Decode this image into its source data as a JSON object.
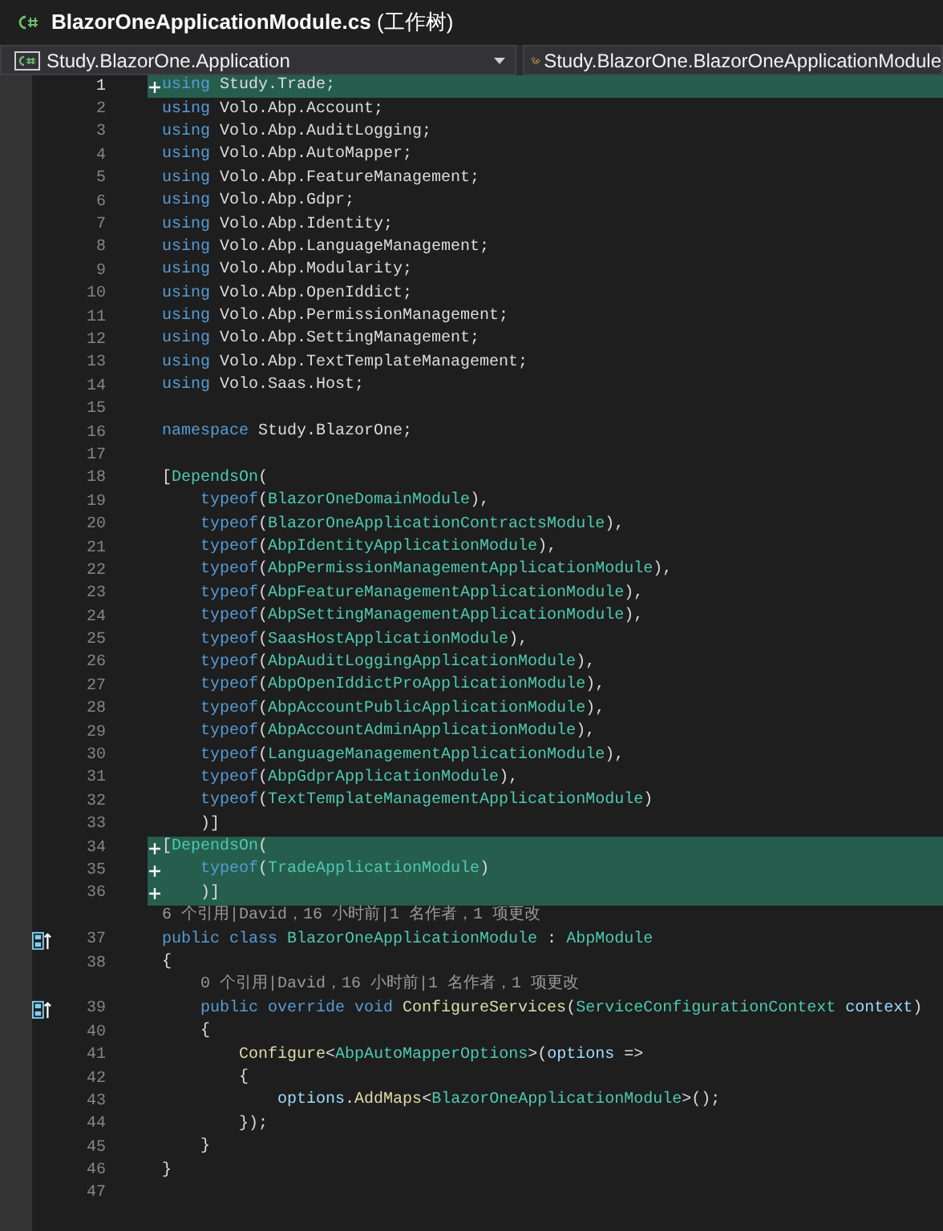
{
  "tab": {
    "title": "BlazorOneApplicationModule.cs",
    "suffix": "(工作树)"
  },
  "navigation": {
    "project": "Study.BlazorOne.Application",
    "member": "Study.BlazorOne.BlazorOneApplicationModule"
  },
  "lines": [
    {
      "kind": "code",
      "number": "1",
      "current": true,
      "added": true,
      "tokens": [
        {
          "kind": "keyword",
          "t": "using"
        },
        {
          "kind": "plain",
          "t": " Study.Trade;"
        }
      ]
    },
    {
      "kind": "code",
      "number": "2",
      "tokens": [
        {
          "kind": "keyword",
          "t": "using"
        },
        {
          "kind": "plain",
          "t": " Volo.Abp.Account;"
        }
      ]
    },
    {
      "kind": "code",
      "number": "3",
      "tokens": [
        {
          "kind": "keyword",
          "t": "using"
        },
        {
          "kind": "plain",
          "t": " Volo.Abp.AuditLogging;"
        }
      ]
    },
    {
      "kind": "code",
      "number": "4",
      "tokens": [
        {
          "kind": "keyword",
          "t": "using"
        },
        {
          "kind": "plain",
          "t": " Volo.Abp.AutoMapper;"
        }
      ]
    },
    {
      "kind": "code",
      "number": "5",
      "tokens": [
        {
          "kind": "keyword",
          "t": "using"
        },
        {
          "kind": "plain",
          "t": " Volo.Abp.FeatureManagement;"
        }
      ]
    },
    {
      "kind": "code",
      "number": "6",
      "tokens": [
        {
          "kind": "keyword",
          "t": "using"
        },
        {
          "kind": "plain",
          "t": " Volo.Abp.Gdpr;"
        }
      ]
    },
    {
      "kind": "code",
      "number": "7",
      "tokens": [
        {
          "kind": "keyword",
          "t": "using"
        },
        {
          "kind": "plain",
          "t": " Volo.Abp.Identity;"
        }
      ]
    },
    {
      "kind": "code",
      "number": "8",
      "tokens": [
        {
          "kind": "keyword",
          "t": "using"
        },
        {
          "kind": "plain",
          "t": " Volo.Abp.LanguageManagement;"
        }
      ]
    },
    {
      "kind": "code",
      "number": "9",
      "tokens": [
        {
          "kind": "keyword",
          "t": "using"
        },
        {
          "kind": "plain",
          "t": " Volo.Abp.Modularity;"
        }
      ]
    },
    {
      "kind": "code",
      "number": "10",
      "tokens": [
        {
          "kind": "keyword",
          "t": "using"
        },
        {
          "kind": "plain",
          "t": " Volo.Abp.OpenIddict;"
        }
      ]
    },
    {
      "kind": "code",
      "number": "11",
      "tokens": [
        {
          "kind": "keyword",
          "t": "using"
        },
        {
          "kind": "plain",
          "t": " Volo.Abp.PermissionManagement;"
        }
      ]
    },
    {
      "kind": "code",
      "number": "12",
      "tokens": [
        {
          "kind": "keyword",
          "t": "using"
        },
        {
          "kind": "plain",
          "t": " Volo.Abp.SettingManagement;"
        }
      ]
    },
    {
      "kind": "code",
      "number": "13",
      "tokens": [
        {
          "kind": "keyword",
          "t": "using"
        },
        {
          "kind": "plain",
          "t": " Volo.Abp.TextTemplateManagement;"
        }
      ]
    },
    {
      "kind": "code",
      "number": "14",
      "tokens": [
        {
          "kind": "keyword",
          "t": "using"
        },
        {
          "kind": "plain",
          "t": " Volo.Saas.Host;"
        }
      ]
    },
    {
      "kind": "code",
      "number": "15"
    },
    {
      "kind": "code",
      "number": "16",
      "tokens": [
        {
          "kind": "keyword",
          "t": "namespace"
        },
        {
          "kind": "plain",
          "t": " Study.BlazorOne;"
        }
      ]
    },
    {
      "kind": "code",
      "number": "17"
    },
    {
      "kind": "code",
      "number": "18",
      "tokens": [
        {
          "kind": "plain",
          "t": "["
        },
        {
          "kind": "type",
          "t": "DependsOn"
        },
        {
          "kind": "plain",
          "t": "("
        }
      ]
    },
    {
      "kind": "code",
      "number": "19",
      "tokens": [
        {
          "kind": "keyword",
          "t": "    typeof"
        },
        {
          "kind": "plain",
          "t": "("
        },
        {
          "kind": "type",
          "t": "BlazorOneDomainModule"
        },
        {
          "kind": "plain",
          "t": "),"
        }
      ]
    },
    {
      "kind": "code",
      "number": "20",
      "tokens": [
        {
          "kind": "keyword",
          "t": "    typeof"
        },
        {
          "kind": "plain",
          "t": "("
        },
        {
          "kind": "type",
          "t": "BlazorOneApplicationContractsModule"
        },
        {
          "kind": "plain",
          "t": "),"
        }
      ]
    },
    {
      "kind": "code",
      "number": "21",
      "tokens": [
        {
          "kind": "keyword",
          "t": "    typeof"
        },
        {
          "kind": "plain",
          "t": "("
        },
        {
          "kind": "type",
          "t": "AbpIdentityApplicationModule"
        },
        {
          "kind": "plain",
          "t": "),"
        }
      ]
    },
    {
      "kind": "code",
      "number": "22",
      "tokens": [
        {
          "kind": "keyword",
          "t": "    typeof"
        },
        {
          "kind": "plain",
          "t": "("
        },
        {
          "kind": "type",
          "t": "AbpPermissionManagementApplicationModule"
        },
        {
          "kind": "plain",
          "t": "),"
        }
      ]
    },
    {
      "kind": "code",
      "number": "23",
      "tokens": [
        {
          "kind": "keyword",
          "t": "    typeof"
        },
        {
          "kind": "plain",
          "t": "("
        },
        {
          "kind": "type",
          "t": "AbpFeatureManagementApplicationModule"
        },
        {
          "kind": "plain",
          "t": "),"
        }
      ]
    },
    {
      "kind": "code",
      "number": "24",
      "tokens": [
        {
          "kind": "keyword",
          "t": "    typeof"
        },
        {
          "kind": "plain",
          "t": "("
        },
        {
          "kind": "type",
          "t": "AbpSettingManagementApplicationModule"
        },
        {
          "kind": "plain",
          "t": "),"
        }
      ]
    },
    {
      "kind": "code",
      "number": "25",
      "tokens": [
        {
          "kind": "keyword",
          "t": "    typeof"
        },
        {
          "kind": "plain",
          "t": "("
        },
        {
          "kind": "type",
          "t": "SaasHostApplicationModule"
        },
        {
          "kind": "plain",
          "t": "),"
        }
      ]
    },
    {
      "kind": "code",
      "number": "26",
      "tokens": [
        {
          "kind": "keyword",
          "t": "    typeof"
        },
        {
          "kind": "plain",
          "t": "("
        },
        {
          "kind": "type",
          "t": "AbpAuditLoggingApplicationModule"
        },
        {
          "kind": "plain",
          "t": "),"
        }
      ]
    },
    {
      "kind": "code",
      "number": "27",
      "tokens": [
        {
          "kind": "keyword",
          "t": "    typeof"
        },
        {
          "kind": "plain",
          "t": "("
        },
        {
          "kind": "type",
          "t": "AbpOpenIddictProApplicationModule"
        },
        {
          "kind": "plain",
          "t": "),"
        }
      ]
    },
    {
      "kind": "code",
      "number": "28",
      "tokens": [
        {
          "kind": "keyword",
          "t": "    typeof"
        },
        {
          "kind": "plain",
          "t": "("
        },
        {
          "kind": "type",
          "t": "AbpAccountPublicApplicationModule"
        },
        {
          "kind": "plain",
          "t": "),"
        }
      ]
    },
    {
      "kind": "code",
      "number": "29",
      "tokens": [
        {
          "kind": "keyword",
          "t": "    typeof"
        },
        {
          "kind": "plain",
          "t": "("
        },
        {
          "kind": "type",
          "t": "AbpAccountAdminApplicationModule"
        },
        {
          "kind": "plain",
          "t": "),"
        }
      ]
    },
    {
      "kind": "code",
      "number": "30",
      "tokens": [
        {
          "kind": "keyword",
          "t": "    typeof"
        },
        {
          "kind": "plain",
          "t": "("
        },
        {
          "kind": "type",
          "t": "LanguageManagementApplicationModule"
        },
        {
          "kind": "plain",
          "t": "),"
        }
      ]
    },
    {
      "kind": "code",
      "number": "31",
      "tokens": [
        {
          "kind": "keyword",
          "t": "    typeof"
        },
        {
          "kind": "plain",
          "t": "("
        },
        {
          "kind": "type",
          "t": "AbpGdprApplicationModule"
        },
        {
          "kind": "plain",
          "t": "),"
        }
      ]
    },
    {
      "kind": "code",
      "number": "32",
      "tokens": [
        {
          "kind": "keyword",
          "t": "    typeof"
        },
        {
          "kind": "plain",
          "t": "("
        },
        {
          "kind": "type",
          "t": "TextTemplateManagementApplicationModule"
        },
        {
          "kind": "plain",
          "t": ")"
        }
      ]
    },
    {
      "kind": "code",
      "number": "33",
      "tokens": [
        {
          "kind": "plain",
          "t": "    )]"
        }
      ]
    },
    {
      "kind": "code",
      "number": "34",
      "added": true,
      "tokens": [
        {
          "kind": "plain",
          "t": "["
        },
        {
          "kind": "type",
          "t": "DependsOn"
        },
        {
          "kind": "plain",
          "t": "("
        }
      ]
    },
    {
      "kind": "code",
      "number": "35",
      "added": true,
      "tokens": [
        {
          "kind": "keyword",
          "t": "    typeof"
        },
        {
          "kind": "plain",
          "t": "("
        },
        {
          "kind": "type",
          "t": "TradeApplicationModule"
        },
        {
          "kind": "plain",
          "t": ")"
        }
      ]
    },
    {
      "kind": "code",
      "number": "36",
      "added": true,
      "tokens": [
        {
          "kind": "plain",
          "t": "    )]"
        }
      ]
    },
    {
      "kind": "lens",
      "text": "6 个引用|David，16 小时前|1 名作者，1 项更改"
    },
    {
      "kind": "code",
      "number": "37",
      "marker": true,
      "tokens": [
        {
          "kind": "keyword",
          "t": "public class"
        },
        {
          "kind": "type",
          "t": " BlazorOneApplicationModule"
        },
        {
          "kind": "plain",
          "t": " : "
        },
        {
          "kind": "type",
          "t": "AbpModule"
        }
      ]
    },
    {
      "kind": "code",
      "number": "38",
      "tokens": [
        {
          "kind": "plain",
          "t": "{"
        }
      ]
    },
    {
      "kind": "lens",
      "text": "    0 个引用|David，16 小时前|1 名作者，1 项更改"
    },
    {
      "kind": "code",
      "number": "39",
      "marker": true,
      "tokens": [
        {
          "kind": "keyword",
          "t": "    public override void"
        },
        {
          "kind": "method",
          "t": " ConfigureServices"
        },
        {
          "kind": "plain",
          "t": "("
        },
        {
          "kind": "type",
          "t": "ServiceConfigurationContext"
        },
        {
          "kind": "param",
          "t": " context"
        },
        {
          "kind": "plain",
          "t": ")"
        }
      ]
    },
    {
      "kind": "code",
      "number": "40",
      "tokens": [
        {
          "kind": "plain",
          "t": "    {"
        }
      ]
    },
    {
      "kind": "code",
      "number": "41",
      "tokens": [
        {
          "kind": "method",
          "t": "        Configure"
        },
        {
          "kind": "plain",
          "t": "<"
        },
        {
          "kind": "type",
          "t": "AbpAutoMapperOptions"
        },
        {
          "kind": "plain",
          "t": ">("
        },
        {
          "kind": "param",
          "t": "options"
        },
        {
          "kind": "plain",
          "t": " =>"
        }
      ]
    },
    {
      "kind": "code",
      "number": "42",
      "tokens": [
        {
          "kind": "plain",
          "t": "        {"
        }
      ]
    },
    {
      "kind": "code",
      "number": "43",
      "tokens": [
        {
          "kind": "param",
          "t": "            options"
        },
        {
          "kind": "plain",
          "t": "."
        },
        {
          "kind": "method",
          "t": "AddMaps"
        },
        {
          "kind": "plain",
          "t": "<"
        },
        {
          "kind": "type",
          "t": "BlazorOneApplicationModule"
        },
        {
          "kind": "plain",
          "t": ">();"
        }
      ]
    },
    {
      "kind": "code",
      "number": "44",
      "tokens": [
        {
          "kind": "plain",
          "t": "        });"
        }
      ]
    },
    {
      "kind": "code",
      "number": "45",
      "tokens": [
        {
          "kind": "plain",
          "t": "    }"
        }
      ]
    },
    {
      "kind": "code",
      "number": "46",
      "tokens": [
        {
          "kind": "plain",
          "t": "}"
        }
      ]
    },
    {
      "kind": "code",
      "number": "47"
    }
  ]
}
